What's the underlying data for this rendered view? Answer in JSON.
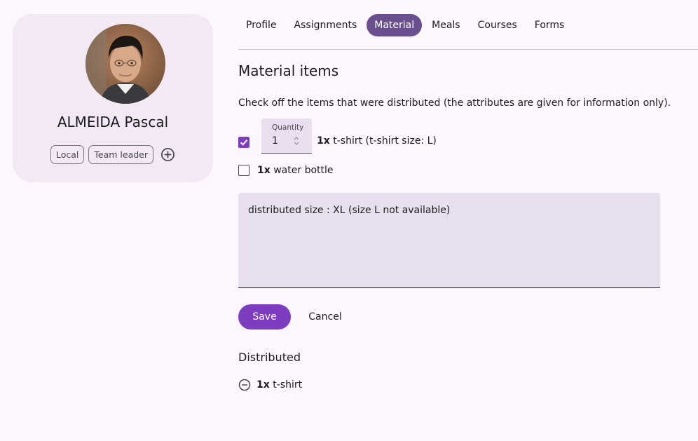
{
  "profile": {
    "name": "ALMEIDA Pascal",
    "tags": [
      "Local",
      "Team leader"
    ]
  },
  "tabs": [
    "Profile",
    "Assignments",
    "Material",
    "Meals",
    "Courses",
    "Forms"
  ],
  "active_tab": "Material",
  "section": {
    "title": "Material items",
    "instructions": "Check off the items that were distributed (the attributes are given for information only)."
  },
  "items": [
    {
      "checked": true,
      "quantity_label": "Quantity",
      "quantity": "1",
      "count": "1x",
      "name": "t-shirt (t-shirt size: L)"
    },
    {
      "checked": false,
      "count": "1x",
      "name": "water bottle"
    }
  ],
  "notes": "distributed size : XL (size L not available)",
  "buttons": {
    "save": "Save",
    "cancel": "Cancel"
  },
  "distributed": {
    "title": "Distributed",
    "items": [
      {
        "count": "1x",
        "name": "t-shirt"
      }
    ]
  },
  "colors": {
    "primary": "#7e3dc0",
    "active_tab": "#6a4f8e",
    "background": "#fcf6fd",
    "card": "#f3e9f4"
  }
}
